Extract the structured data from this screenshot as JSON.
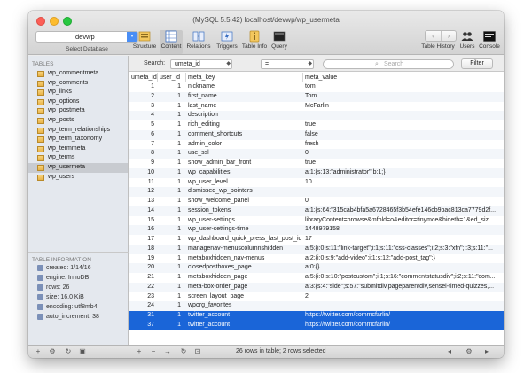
{
  "window": {
    "title": "(MySQL 5.5.42) localhost/devwp/wp_usermeta"
  },
  "database": {
    "selected": "devwp",
    "label": "Select Database"
  },
  "toolbar": {
    "structure": "Structure",
    "content": "Content",
    "relations": "Relations",
    "triggers": "Triggers",
    "table_info": "Table Info",
    "query": "Query",
    "table_history": "Table History",
    "users": "Users",
    "console": "Console"
  },
  "sidebar": {
    "tables_heading": "TABLES",
    "tables": [
      "wp_commentmeta",
      "wp_comments",
      "wp_links",
      "wp_options",
      "wp_postmeta",
      "wp_posts",
      "wp_term_relationships",
      "wp_term_taxonomy",
      "wp_termmeta",
      "wp_terms",
      "wp_usermeta",
      "wp_users"
    ],
    "selected_table": "wp_usermeta",
    "info_heading": "TABLE INFORMATION",
    "info": [
      "created: 1/14/16",
      "engine: InnoDB",
      "rows: 26",
      "size: 16.0 KiB",
      "encoding: utf8mb4",
      "auto_increment: 38"
    ]
  },
  "search": {
    "label": "Search:",
    "field": "umeta_id",
    "operator": "=",
    "placeholder": "Search",
    "filter_button": "Filter"
  },
  "grid": {
    "columns": [
      "umeta_id",
      "user_id",
      "meta_key",
      "meta_value"
    ],
    "rows": [
      [
        "1",
        "1",
        "nickname",
        "tom"
      ],
      [
        "2",
        "1",
        "first_name",
        "Tom"
      ],
      [
        "3",
        "1",
        "last_name",
        "McFarlin"
      ],
      [
        "4",
        "1",
        "description",
        ""
      ],
      [
        "5",
        "1",
        "rich_editing",
        "true"
      ],
      [
        "6",
        "1",
        "comment_shortcuts",
        "false"
      ],
      [
        "7",
        "1",
        "admin_color",
        "fresh"
      ],
      [
        "8",
        "1",
        "use_ssl",
        "0"
      ],
      [
        "9",
        "1",
        "show_admin_bar_front",
        "true"
      ],
      [
        "10",
        "1",
        "wp_capabilities",
        "a:1:{s:13:\"administrator\";b:1;}"
      ],
      [
        "11",
        "1",
        "wp_user_level",
        "10"
      ],
      [
        "12",
        "1",
        "dismissed_wp_pointers",
        ""
      ],
      [
        "13",
        "1",
        "show_welcome_panel",
        "0"
      ],
      [
        "14",
        "1",
        "session_tokens",
        "a:1:{s:64:\"315cab4bfa5a6728465f3b54efe146cb9bac813ca7779d2f..."
      ],
      [
        "15",
        "1",
        "wp_user-settings",
        "libraryContent=browse&mfold=o&editor=tinymce&hidetb=1&ed_siz..."
      ],
      [
        "16",
        "1",
        "wp_user-settings-time",
        "1448979158"
      ],
      [
        "17",
        "1",
        "wp_dashboard_quick_press_last_post_id",
        "17"
      ],
      [
        "18",
        "1",
        "managenav-menuscolumnshidden",
        "a:5:{i:0;s:11:\"link-target\";i:1;s:11:\"css-classes\";i:2;s:3:\"xfn\";i:3;s:11:\"..."
      ],
      [
        "19",
        "1",
        "metaboxhidden_nav-menus",
        "a:2:{i:0;s:9:\"add-video\";i:1;s:12:\"add-post_tag\";}"
      ],
      [
        "20",
        "1",
        "closedpostboxes_page",
        "a:0:{}"
      ],
      [
        "21",
        "1",
        "metaboxhidden_page",
        "a:5:{i:0;s:10:\"postcustom\";i:1;s:16:\"commentstatusdiv\";i:2;s:11:\"com..."
      ],
      [
        "22",
        "1",
        "meta-box-order_page",
        "a:3:{s:4:\"side\";s:57:\"submitdiv,pageparentdiv,sensei-timed-quizzes,..."
      ],
      [
        "23",
        "1",
        "screen_layout_page",
        "2"
      ],
      [
        "24",
        "1",
        "wporg_favorites",
        ""
      ],
      [
        "31",
        "1",
        "twitter_account",
        "https://twitter.com/commcfarlin/"
      ],
      [
        "37",
        "1",
        "twitter_account",
        "https://twitter.com/commcfarlin/"
      ]
    ],
    "selected_rows": [
      24,
      25
    ]
  },
  "status": {
    "text": "26 rows in table; 2 rows selected"
  },
  "colors": {
    "selection": "#1a65d8",
    "accent": "#4a8ef5"
  }
}
